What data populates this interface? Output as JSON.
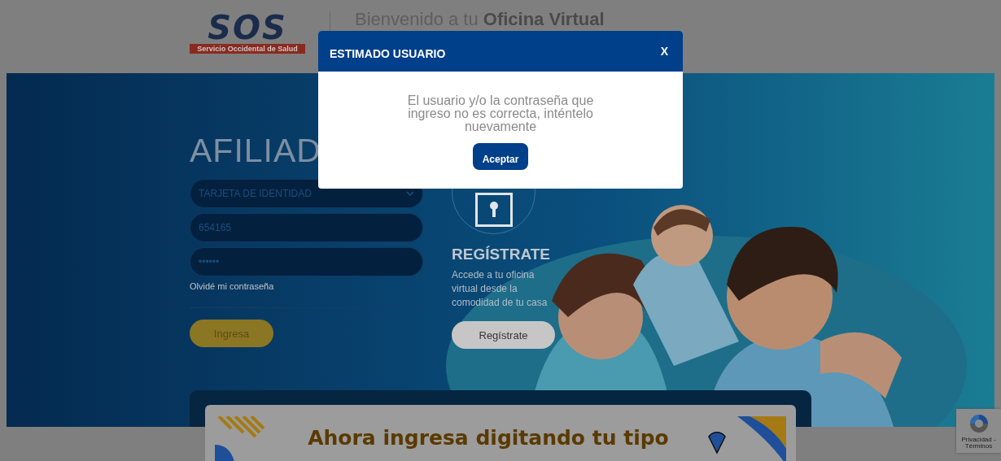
{
  "header": {
    "logo": {
      "wordmark": "SOS",
      "tagline": "Servicio Occidental de Salud"
    },
    "title": "Bienvenido a tu **Oficina Virtual**"
  },
  "login": {
    "heading": "AFILIAD",
    "document_type": {
      "value": "TARJETA DE IDENTIDAD"
    },
    "id_number": {
      "value": "654165"
    },
    "password": {
      "value": "••••••"
    },
    "forgot_link": "Olvidé mi contraseña",
    "submit": "Ingresa"
  },
  "register": {
    "heading": "REGÍSTRATE",
    "text": "Accede a tu oficina virtual desde la comodidad de tu casa",
    "button": "Regístrate"
  },
  "banner": {
    "text": "Ahora ingresa digitando tu tipo"
  },
  "recaptcha": {
    "links": "Privacidad - Términos"
  },
  "dialog": {
    "title": "ESTIMADO USUARIO",
    "close": "X",
    "message": "El usuario y/o la contraseña que ingreso no es correcta, inténtelo nuevamente",
    "button": "Aceptar"
  }
}
